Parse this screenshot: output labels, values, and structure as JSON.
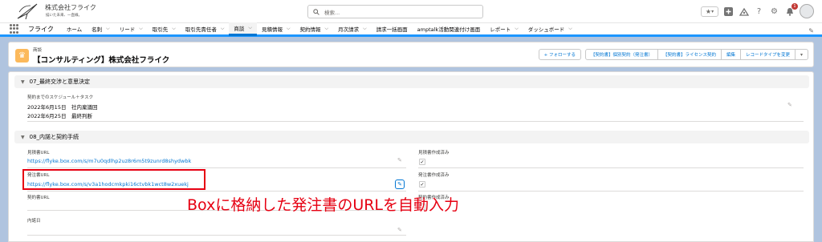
{
  "header": {
    "company_name": "株式会社フライク",
    "tagline": "描いた未来、一直線。",
    "search_placeholder": "検索..."
  },
  "nav": {
    "app_name": "フライク",
    "items": [
      {
        "label": "ホーム",
        "dropdown": false
      },
      {
        "label": "名刺",
        "dropdown": true
      },
      {
        "label": "リード",
        "dropdown": true
      },
      {
        "label": "取引先",
        "dropdown": true
      },
      {
        "label": "取引先責任者",
        "dropdown": true
      },
      {
        "label": "商談",
        "dropdown": true,
        "active": true
      },
      {
        "label": "見積情報",
        "dropdown": true
      },
      {
        "label": "契約情報",
        "dropdown": true
      },
      {
        "label": "月次請求",
        "dropdown": true
      },
      {
        "label": "請求一括画面",
        "dropdown": false
      },
      {
        "label": "amptalk活動関連付け画面",
        "dropdown": false
      },
      {
        "label": "レポート",
        "dropdown": true
      },
      {
        "label": "ダッシュボード",
        "dropdown": true
      }
    ]
  },
  "record": {
    "object_type": "商談",
    "title": "【コンサルティング】株式会社フライク",
    "buttons": {
      "follow": "+ フォローする",
      "contract_individual": "【契約書】個別契約（発注書）",
      "contract_license": "【契約書】ライセンス契約",
      "edit": "編集",
      "change_record_type": "レコードタイプを変更"
    }
  },
  "sections": {
    "s07": {
      "title": "07_最終交渉と意思決定",
      "schedule_label": "契約までのスケジュール＋タスク",
      "schedule_line1": "2022年6月15日　社内稟議回",
      "schedule_line2": "2022年6月25日　最終判断"
    },
    "s08": {
      "title": "08_内諾と契約手続",
      "estimate_url_label": "見積書URL",
      "estimate_url": "https://flyke.box.com/s/m7u0qdlhp2uz8r6m5t9zunrd8shydwbk",
      "estimate_done_label": "見積書作成済み",
      "order_url_label": "発注書URL",
      "order_url": "https://flyke.box.com/s/v3a1hodcmkpki16ctvbk1wct8w2xuekj",
      "order_done_label": "発注書作成済み",
      "contract_url_label": "契約書URL",
      "contract_done_label": "契約書作成済み",
      "agreement_date_label": "内諾日"
    }
  },
  "annotation": "Boxに格納した発注書のURLを自動入力"
}
